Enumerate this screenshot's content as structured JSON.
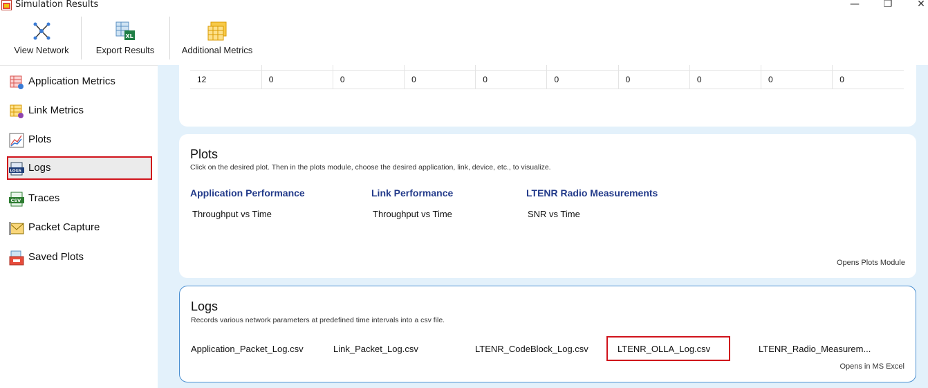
{
  "window": {
    "title": "Simulation Results",
    "minimize": "—",
    "maximize": "❐",
    "close": "✕"
  },
  "ribbon": {
    "view_network": "View Network",
    "export_results": "Export Results",
    "additional_metrics": "Additional Metrics"
  },
  "sidebar": {
    "items": [
      {
        "label": "Application Metrics",
        "icon": "application-metrics-icon"
      },
      {
        "label": "Link Metrics",
        "icon": "link-metrics-icon"
      },
      {
        "label": "Plots",
        "icon": "plots-icon"
      },
      {
        "label": "Logs",
        "icon": "logs-icon",
        "active": true
      },
      {
        "label": "Traces",
        "icon": "csv-icon"
      },
      {
        "label": "Packet Capture",
        "icon": "envelope-icon"
      },
      {
        "label": "Saved Plots",
        "icon": "saved-plots-icon"
      }
    ]
  },
  "metrics_table": {
    "row": [
      "12",
      "0",
      "0",
      "0",
      "0",
      "0",
      "0",
      "0",
      "0",
      "0"
    ]
  },
  "plots": {
    "title": "Plots",
    "description": "Click on the desired plot. Then in the plots module, choose the desired application, link, device, etc., to visualize.",
    "columns": [
      {
        "heading": "Application Performance",
        "link": "Throughput vs Time"
      },
      {
        "heading": "Link Performance",
        "link": "Throughput vs Time"
      },
      {
        "heading": "LTENR Radio Measurements",
        "link": "SNR vs Time"
      }
    ],
    "footer": "Opens Plots Module"
  },
  "logs": {
    "title": "Logs",
    "description": "Records various network parameters at predefined time intervals into a csv file.",
    "files": [
      "Application_Packet_Log.csv",
      "Link_Packet_Log.csv",
      "LTENR_CodeBlock_Log.csv",
      "LTENR_OLLA_Log.csv",
      "LTENR_Radio_Measurem..."
    ],
    "footer": "Opens in MS Excel"
  },
  "colors": {
    "accent_blue": "#223a8a",
    "highlight_red": "#d0121b",
    "content_bg": "#e3f1fb"
  }
}
